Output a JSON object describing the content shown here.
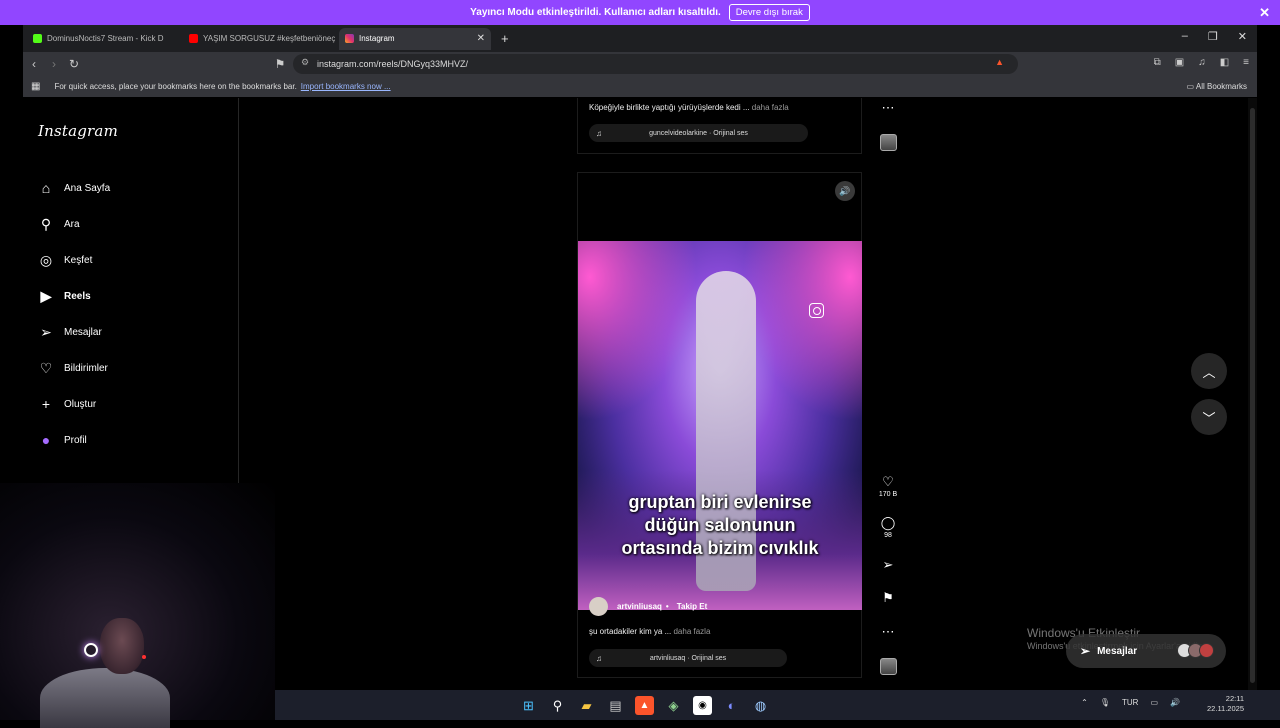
{
  "banner": {
    "text": "Yayıncı Modu etkinleştirildi. Kullanıcı adları kısaltıldı.",
    "button": "Devre dışı bırak",
    "close": "✕"
  },
  "tabs": [
    {
      "title": "DominusNoctis7 Stream - Kick D",
      "color": "#53fc18",
      "active": false
    },
    {
      "title": "YAŞIM SORGUSUZ #keşfetbeniöneçı",
      "color": "#ff0000",
      "active": false
    },
    {
      "title": "Instagram",
      "color": "#e1306c",
      "active": true
    }
  ],
  "addressbar": {
    "url": "instagram.com/reels/DNGyq33MHVZ/"
  },
  "bookmarks": {
    "hint": "For quick access, place your bookmarks here on the bookmarks bar.",
    "import_link": "Import bookmarks now ...",
    "all": "All Bookmarks"
  },
  "sidebar": {
    "logo": "Instagram",
    "items": [
      {
        "label": "Ana Sayfa",
        "icon": "home-icon",
        "glyph": "⌂",
        "bold": false
      },
      {
        "label": "Ara",
        "icon": "search-icon",
        "glyph": "⚲",
        "bold": false
      },
      {
        "label": "Keşfet",
        "icon": "compass-icon",
        "glyph": "◎",
        "bold": false
      },
      {
        "label": "Reels",
        "icon": "reels-icon",
        "glyph": "▶",
        "bold": true
      },
      {
        "label": "Mesajlar",
        "icon": "send-icon",
        "glyph": "➢",
        "bold": false
      },
      {
        "label": "Bildirimler",
        "icon": "heart-icon",
        "glyph": "♡",
        "bold": false
      },
      {
        "label": "Oluştur",
        "icon": "plus-icon",
        "glyph": "+",
        "bold": false
      },
      {
        "label": "Profil",
        "icon": "profile-avatar-icon",
        "glyph": "●",
        "bold": false
      }
    ]
  },
  "previous_reel": {
    "caption": "Köpeğiyle birlikte yaptığı yürüyüşlerde kedi ...",
    "more": "daha fazla",
    "audio": "guncelvideolarkine · Orijinal ses"
  },
  "reel": {
    "overlay_lines": [
      "gruptan biri evlenirse",
      "düğün salonunun",
      "ortasında bizim cıvıklık"
    ],
    "author": "artvinliusaq",
    "separator": "•",
    "follow": "Takip Et",
    "caption": "şu ortadakiler kim ya ...",
    "more": "daha fazla",
    "audio": "artvinliusaq · Orijinal ses",
    "likes": "170 B",
    "comments": "98"
  },
  "watermark": {
    "title": "Windows'u Etkinleştir",
    "subtitle": "Windows'u etkinleştirmek için Ayarlar'a gidin."
  },
  "messages_pill": {
    "label": "Mesajlar"
  },
  "taskbar": {
    "lang": "TUR",
    "time": "22:11",
    "date": "22.11.2025"
  }
}
